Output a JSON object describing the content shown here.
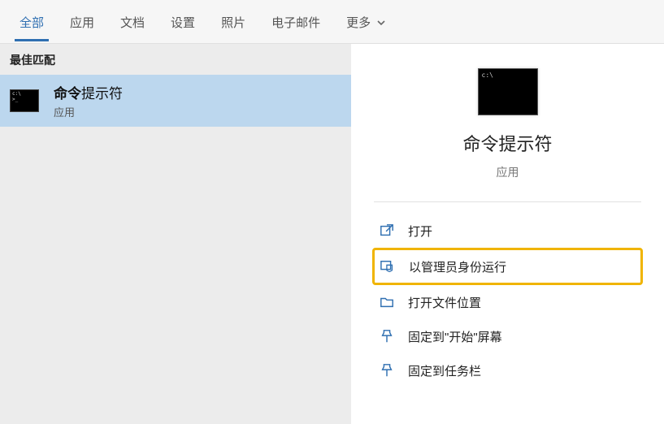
{
  "tabs": {
    "all": "全部",
    "apps": "应用",
    "docs": "文档",
    "settings": "设置",
    "photos": "照片",
    "email": "电子邮件",
    "more": "更多"
  },
  "left": {
    "section_best_match": "最佳匹配",
    "result": {
      "title_highlight": "命令",
      "title_rest": "提示符",
      "subtitle": "应用"
    }
  },
  "right": {
    "title": "命令提示符",
    "subtitle": "应用",
    "actions": {
      "open": "打开",
      "run_as_admin": "以管理员身份运行",
      "open_file_location": "打开文件位置",
      "pin_to_start": "固定到\"开始\"屏幕",
      "pin_to_taskbar": "固定到任务栏"
    }
  }
}
